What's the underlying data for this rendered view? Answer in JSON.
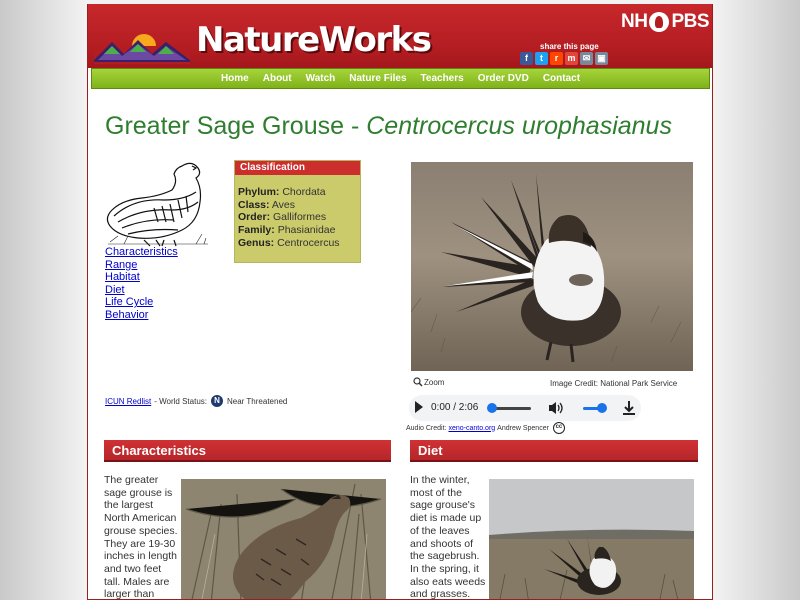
{
  "header": {
    "site_title": "NatureWorks",
    "pbs_logo_text_left": "NH",
    "pbs_logo_text_right": "PBS",
    "share_label": "share this page",
    "share_icons": [
      "facebook-icon",
      "twitter-icon",
      "reddit-icon",
      "mix-icon",
      "email-icon",
      "print-icon"
    ]
  },
  "nav": {
    "items": [
      "Home",
      "About",
      "Watch",
      "Nature Files",
      "Teachers",
      "Order DVD",
      "Contact"
    ]
  },
  "species": {
    "common_name": "Greater Sage Grouse - ",
    "scientific_name": "Centrocercus urophasianus"
  },
  "links": [
    "Characteristics",
    "Range",
    "Habitat",
    "Diet",
    "Life Cycle",
    "Behavior"
  ],
  "classification": {
    "heading": "Classification",
    "rows": [
      {
        "label": "Phylum:",
        "value": "Chordata"
      },
      {
        "label": "Class:",
        "value": "Aves"
      },
      {
        "label": "Order:",
        "value": "Galliformes"
      },
      {
        "label": "Family:",
        "value": "Phasianidae"
      },
      {
        "label": "Genus:",
        "value": " Centrocercus"
      }
    ]
  },
  "status": {
    "link": "ICUN Redlist",
    "text": "- World Status:",
    "badge": "N",
    "value": "Near Threatened"
  },
  "media": {
    "zoom_label": "Zoom",
    "image_credit": "Image Credit:  National Park Service",
    "audio_time": "0:00 / 2:06",
    "audio_progress": 0,
    "audio_volume": 1,
    "audio_credit_prefix": "Audio Credit:",
    "audio_credit_link": "xeno-canto.org",
    "audio_credit_name": "Andrew Spencer",
    "cc_badge": "cc"
  },
  "characteristics": {
    "heading": "Characteristics",
    "text": "The greater sage grouse is the largest North American grouse species. They are 19-30 inches in length and two feet tall. Males are larger than females. Both"
  },
  "diet": {
    "heading": "Diet",
    "text": "In the winter, most of the sage grouse's diet is made up of the leaves and shoots of the sagebrush. In the spring, it also eats weeds and grasses."
  },
  "colors": {
    "header_red": "#b31d22",
    "nav_green": "#8cc12a",
    "title_green": "#2f7d2f",
    "classification_bg": "#cbcb6c",
    "link_blue": "#0000cc"
  }
}
